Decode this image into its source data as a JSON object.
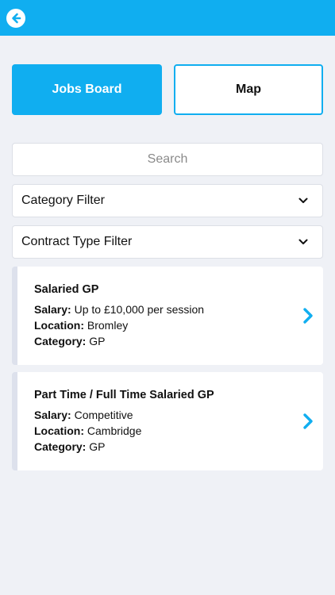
{
  "toggle": {
    "jobs_label": "Jobs Board",
    "map_label": "Map"
  },
  "search": {
    "placeholder": "Search"
  },
  "filters": {
    "category": "Category Filter",
    "contract": "Contract Type Filter"
  },
  "jobs": [
    {
      "title": "Salaried GP",
      "salary_label": "Salary:",
      "salary": "Up to £10,000 per session",
      "location_label": "Location:",
      "location": "Bromley",
      "category_label": "Category:",
      "category": "GP"
    },
    {
      "title": "Part Time / Full Time Salaried GP",
      "salary_label": "Salary:",
      "salary": "Competitive",
      "location_label": "Location:",
      "location": "Cambridge",
      "category_label": "Category:",
      "category": "GP"
    }
  ],
  "icons": {
    "back": "arrow-left-circle-icon",
    "dropdown": "chevron-down-icon",
    "row_arrow": "chevron-right-icon"
  },
  "colors": {
    "accent": "#10aef0",
    "background": "#eff1f6",
    "card": "#ffffff"
  }
}
